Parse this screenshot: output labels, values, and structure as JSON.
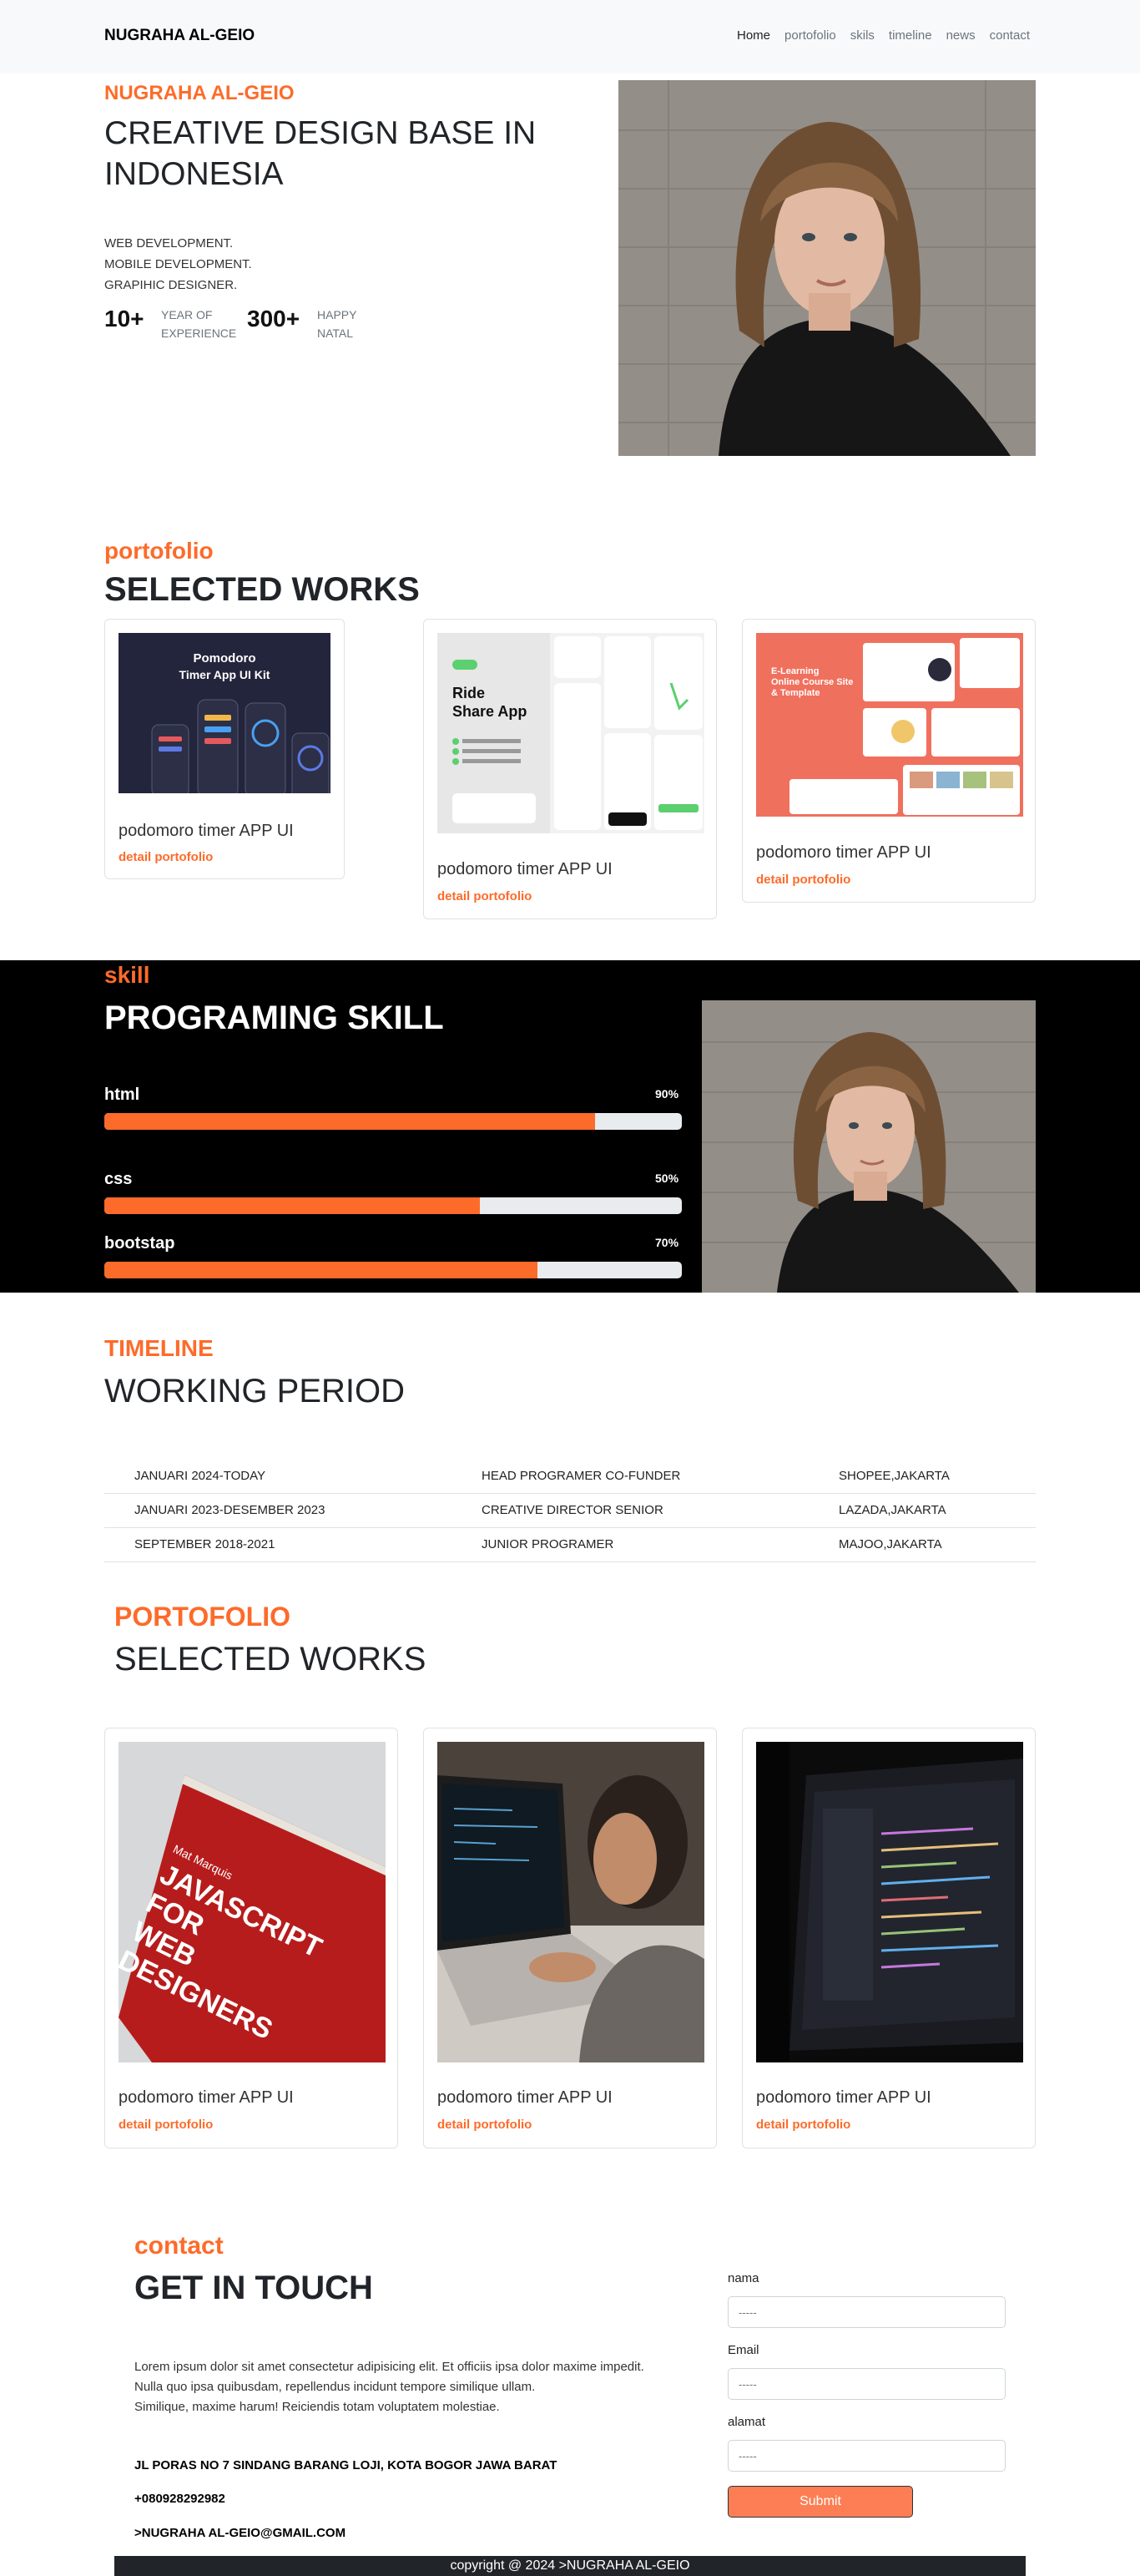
{
  "nav": {
    "brand": "NUGRAHA AL-GEIO",
    "links": [
      "Home",
      "portofolio",
      "skils",
      "timeline",
      "news",
      "contact"
    ]
  },
  "hero": {
    "eyebrow": "NUGRAHA AL-GEIO",
    "title": "CREATIVE DESIGN BASE IN INDONESIA",
    "services": [
      "WEB DEVELOPMENT.",
      "MOBILE DEVELOPMENT.",
      "GRAPIHIC DESIGNER."
    ],
    "stats": [
      {
        "number": "10+",
        "label_line1": "YEAR OF",
        "label_line2": "EXPERIENCE"
      },
      {
        "number": "300+",
        "label_line1": "HAPPY",
        "label_line2": "NATAL"
      }
    ]
  },
  "portfolio": {
    "eyebrow": "portofolio",
    "title": "SELECTED WORKS",
    "cards": [
      {
        "title": "podomoro timer APP UI",
        "link": "detail portofolio",
        "image_heading": "Pomodoro",
        "image_subheading": "Timer App UI  Kit"
      },
      {
        "title": "podomoro timer APP UI",
        "link": "detail portofolio",
        "image_heading": "Ride",
        "image_subheading": "Share App"
      },
      {
        "title": "podomoro timer APP UI",
        "link": "detail portofolio",
        "image_heading": "E-Learning",
        "image_subheading": "Online Course Site & Template"
      }
    ]
  },
  "skill": {
    "eyebrow": "skill",
    "title": "PROGRAMING SKILL",
    "items": [
      {
        "name": "html",
        "percent_label": "90%",
        "level": 0.85
      },
      {
        "name": "css",
        "percent_label": "50%",
        "level": 0.65
      },
      {
        "name": "bootstap",
        "percent_label": "70%",
        "level": 0.75
      }
    ]
  },
  "timeline": {
    "eyebrow": "TIMELINE",
    "title": "WORKING PERIOD",
    "rows": [
      {
        "period": "JANUARI 2024-TODAY",
        "role": "HEAD PROGRAMER CO-FUNDER",
        "company": "SHOPEE,JAKARTA"
      },
      {
        "period": "JANUARI 2023-DESEMBER 2023",
        "role": "CREATIVE DIRECTOR SENIOR",
        "company": "LAZADA,JAKARTA"
      },
      {
        "period": "SEPTEMBER 2018-2021",
        "role": "JUNIOR PROGRAMER",
        "company": "MAJOO,JAKARTA"
      }
    ]
  },
  "portfolio2": {
    "eyebrow": "PORTOFOLIO",
    "title": "SELECTED WORKS",
    "book_cover": {
      "author": "Mat Marquis",
      "title_line1": "JAVASCRIPT FOR",
      "title_line2": "WEB DESIGNERS"
    },
    "cards": [
      {
        "title": "podomoro timer APP UI",
        "link": "detail portofolio"
      },
      {
        "title": "podomoro timer APP UI",
        "link": "detail portofolio"
      },
      {
        "title": "podomoro timer APP UI",
        "link": "detail portofolio"
      }
    ]
  },
  "contact": {
    "eyebrow": "contact",
    "title": "GET IN TOUCH",
    "body_lines": [
      "Lorem ipsum dolor sit amet consectetur adipisicing elit. Et officiis ipsa dolor maxime impedit.",
      "Nulla quo ipsa quibusdam, repellendus incidunt tempore similique ullam.",
      "Similique, maxime harum! Reiciendis totam voluptatem molestiae."
    ],
    "address": "JL PORAS NO 7 SINDANG BARANG LOJI, KOTA BOGOR JAWA BARAT",
    "phone": "+080928292982",
    "email": ">NUGRAHA AL-GEIO@GMAIL.COM",
    "form": {
      "name_label": "nama",
      "name_placeholder": "-----",
      "email_label": "Email",
      "email_placeholder": "-----",
      "address_label": "alamat",
      "address_placeholder": "-----",
      "submit_label": "Submit"
    }
  },
  "footer": {
    "text": "copyright @ 2024 >NUGRAHA AL-GEIO"
  },
  "colors": {
    "accent": "#fd6b2a",
    "dark": "#212529",
    "skill_bg": "#000000",
    "nav_bg": "#f8f9fa"
  }
}
